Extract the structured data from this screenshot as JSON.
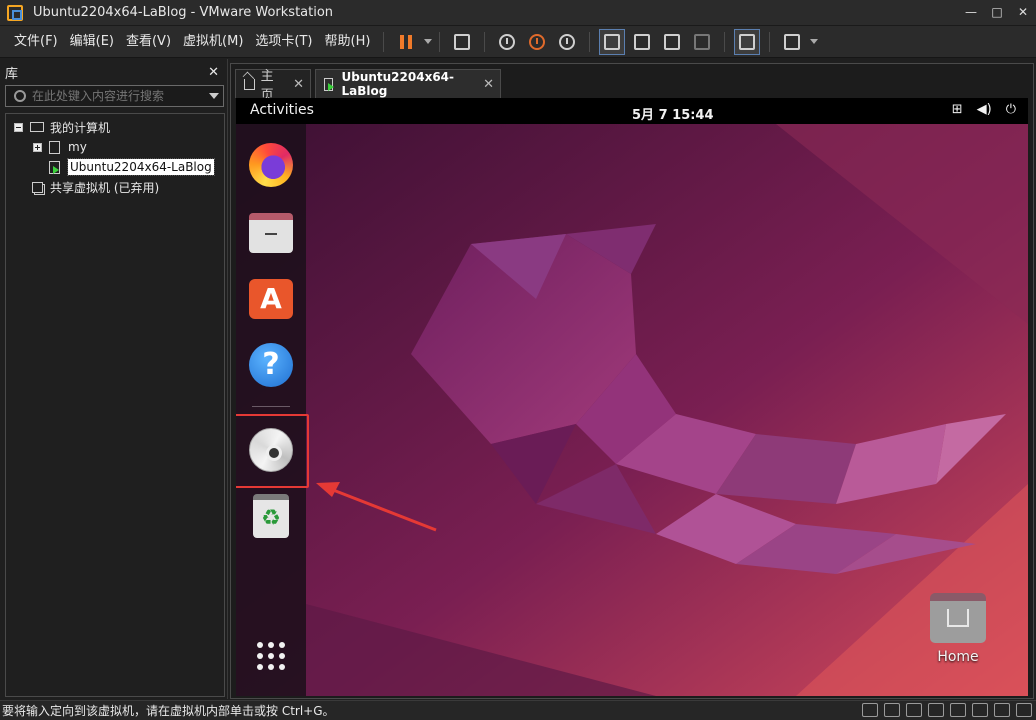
{
  "window": {
    "title": "Ubuntu2204x64-LaBlog - VMware Workstation",
    "controls": [
      "—",
      "□",
      "✕"
    ]
  },
  "menu": [
    "文件(F)",
    "编辑(E)",
    "查看(V)",
    "虚拟机(M)",
    "选项卡(T)",
    "帮助(H)"
  ],
  "library": {
    "title": "库",
    "close": "✕",
    "search_placeholder": "在此处键入内容进行搜索",
    "tree": {
      "root": "我的计算机",
      "children": [
        "my",
        "Ubuntu2204x64-LaBlog"
      ],
      "shared": "共享虚拟机 (已弃用)"
    }
  },
  "tabs": [
    {
      "label": "主页",
      "close": "✕"
    },
    {
      "label": "Ubuntu2204x64-LaBlog",
      "close": "✕"
    }
  ],
  "guest": {
    "activities": "Activities",
    "clock": "5月 7  15:44",
    "system_icons": [
      "network-icon",
      "volume-icon",
      "power-icon"
    ],
    "dock": [
      "firefox",
      "files",
      "app-center",
      "help",
      "cd-disc",
      "trash",
      "show-apps"
    ],
    "desktop_icon": "Home",
    "wallpaper_colors": {
      "dark": "#3c1033",
      "mid": "#8a2559",
      "light": "#d2495a"
    }
  },
  "status": {
    "message": "要将输入定向到该虚拟机，请在虚拟机内部单击或按 Ctrl+G。"
  },
  "colors": {
    "highlight": "#e53935",
    "pause": "#f07a2a"
  }
}
